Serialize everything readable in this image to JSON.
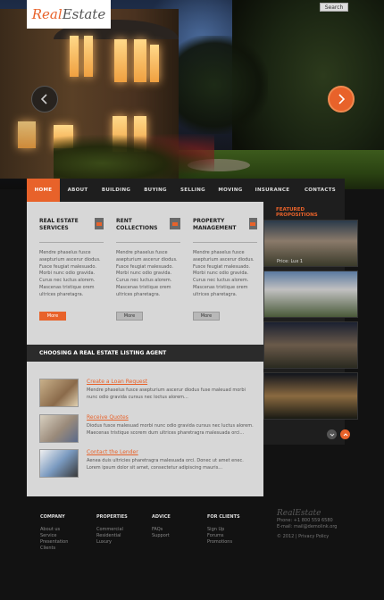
{
  "brand": {
    "part1": "Real",
    "part2": "Estate"
  },
  "search": {
    "label": "Search"
  },
  "nav": [
    {
      "label": "HOME",
      "active": true
    },
    {
      "label": "ABOUT"
    },
    {
      "label": "BUILDING"
    },
    {
      "label": "BUYING"
    },
    {
      "label": "SELLING"
    },
    {
      "label": "MOVING"
    },
    {
      "label": "INSURANCE"
    },
    {
      "label": "CONTACTS"
    }
  ],
  "services": [
    {
      "title": "REAL ESTATE SERVICES",
      "text": "Mendre phaselus fusce asepturium ascerur diodus. Fusce feugiat malesuado. Morbi nunc odio gravida. Curus nec luctus alorem. Mascenas tristique orem ultrices pharetagra.",
      "more": "More"
    },
    {
      "title": "RENT COLLECTIONS",
      "text": "Mendre phaselus fusce asepturium ascerur diodus. Fusce feugiat malesuado. Morbi nunc odio gravida. Curus nec luctus alorem. Mascenas tristique orem ultrices pharetagra.",
      "more": "More"
    },
    {
      "title": "PROPERTY MANAGEMENT",
      "text": "Mendre phaselus fusce asepturium ascerur diodus. Fusce feugiat malesuado. Morbi nunc odio gravida. Curus nec luctus alorem. Mascenas tristique orem ultrices pharetagra.",
      "more": "More"
    }
  ],
  "agent_heading": "CHOOSING A REAL ESTATE LISTING AGENT",
  "agent_links": [
    {
      "title": "Create a Loan Request",
      "text": "Mendre phaselus fusce asepturium ascerur diodus fuse maleuad morbi nunc odio gravida cursus nec loctus alorem..."
    },
    {
      "title": "Receive Quotes",
      "text": "Diodus fusce malesuad morbi nunc odio gravida cursus nec luctus alorem. Maecenas tristique scorem dum ultrices pharetragra malesuada orci..."
    },
    {
      "title": "Contact the Lender",
      "text": "Aenea duis ultricies pharetragra malesuada orci. Donec ut amet enec. Lorem ipsum dolor sit amet, consectetur adipiscing mauris..."
    }
  ],
  "featured": {
    "title": "FEATURED PROPOSITIONS",
    "items": [
      {
        "label": "Price: Lux 1"
      }
    ]
  },
  "footer": {
    "columns": [
      {
        "head": "COMPANY",
        "links": [
          "About us",
          "Service",
          "Presentation",
          "Clients"
        ]
      },
      {
        "head": "PROPERTIES",
        "links": [
          "Commercial",
          "Residential",
          "Luxury"
        ]
      },
      {
        "head": "ADVICE",
        "links": [
          "FAQs",
          "Support"
        ]
      },
      {
        "head": "FOR CLIENTS",
        "links": [
          "Sign Up",
          "Forums",
          "Promotions"
        ]
      }
    ],
    "logo": "RealEstate",
    "phone": "Phone: +1 800 559 6580",
    "email": "E-mail: mail@demolink.org",
    "copyright": "© 2012 | Privacy Policy"
  },
  "colors": {
    "accent": "#e8622a",
    "panel": "#d7d7d7",
    "dark": "#1e1e1e"
  }
}
